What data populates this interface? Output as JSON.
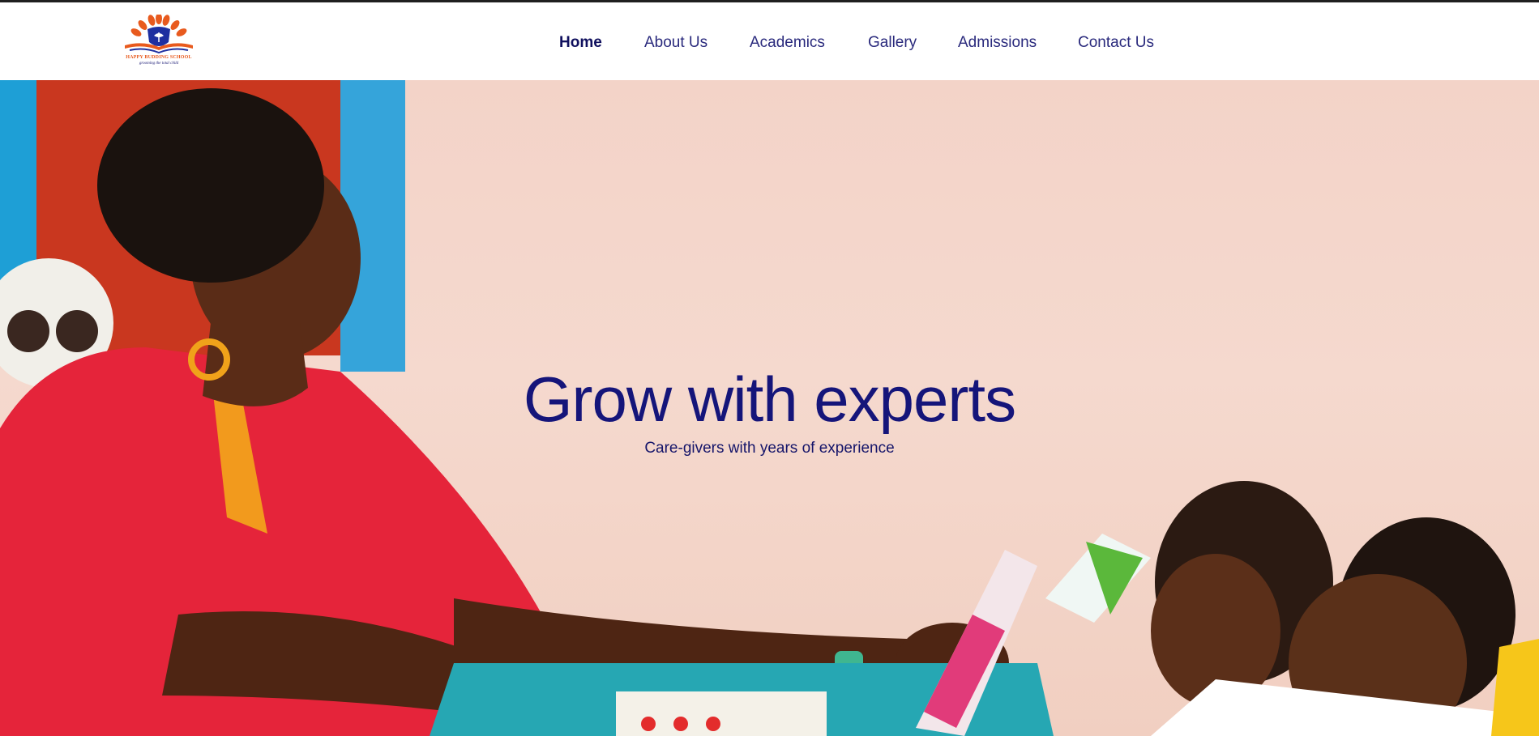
{
  "site": {
    "logo_text": "HAPPY BUDDING SCHOOL",
    "logo_tagline": "grooming the total child"
  },
  "nav": {
    "items": [
      {
        "label": "Home",
        "active": true
      },
      {
        "label": "About Us",
        "active": false
      },
      {
        "label": "Academics",
        "active": false
      },
      {
        "label": "Gallery",
        "active": false
      },
      {
        "label": "Admissions",
        "active": false
      },
      {
        "label": "Contact Us",
        "active": false
      }
    ]
  },
  "hero": {
    "title": "Grow with experts",
    "subtitle": "Care-givers with years of experience",
    "image": "teacher-with-children-photo"
  },
  "colors": {
    "brand_navy": "#15157a",
    "brand_orange": "#e85a1e",
    "header_bg": "#ffffff"
  }
}
